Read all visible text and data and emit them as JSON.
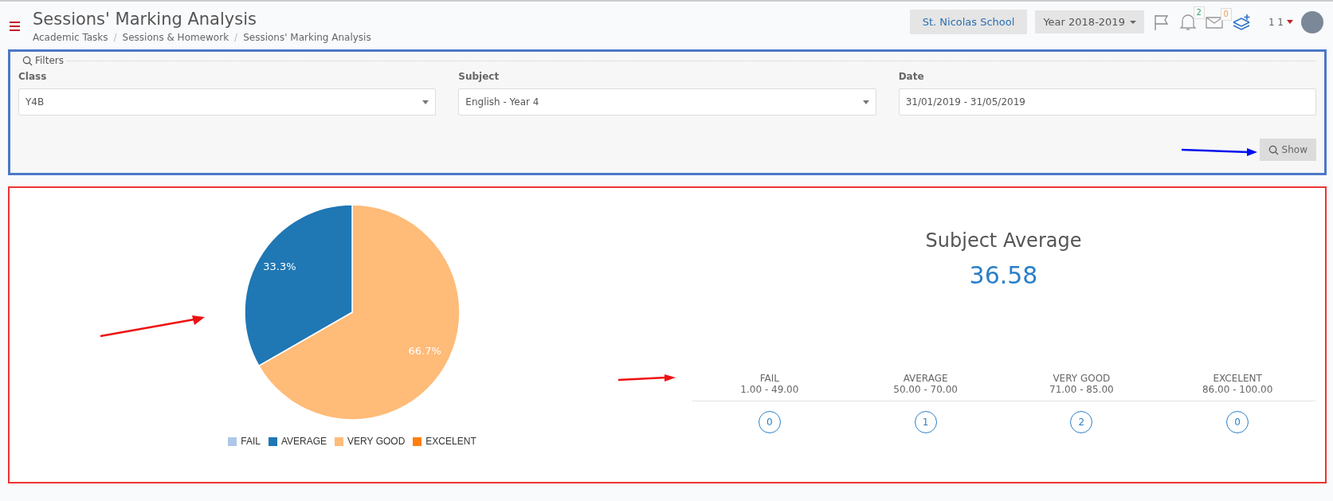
{
  "header": {
    "title": "Sessions' Marking Analysis",
    "breadcrumb": [
      "Academic Tasks",
      "Sessions & Homework",
      "Sessions' Marking Analysis"
    ],
    "school": "St. Nicolas School",
    "year": "Year 2018-2019",
    "separator": "/",
    "notifications": "2",
    "messages": "0",
    "user": "1 1"
  },
  "filters": {
    "legend": "Filters",
    "fields": [
      {
        "label": "Class",
        "value": "Y4B",
        "kind": "select"
      },
      {
        "label": "Subject",
        "value": "English - Year 4",
        "kind": "select"
      },
      {
        "label": "Date",
        "value": "31/01/2019 - 31/05/2019",
        "kind": "text"
      }
    ],
    "button": "Show"
  },
  "chart_data": {
    "type": "pie",
    "categories": [
      "FAIL",
      "AVERAGE",
      "VERY GOOD",
      "EXCELENT"
    ],
    "values": [
      0,
      33.3,
      66.7,
      0
    ],
    "colors": [
      "#aec7e8",
      "#1f77b4",
      "#ffbb78",
      "#ff7f0e"
    ],
    "data_labels": true,
    "value_labels": [
      null,
      "33.3%",
      "66.7%",
      null
    ],
    "legend": "bottom"
  },
  "average": {
    "title": "Subject Average",
    "value": "36.58"
  },
  "grades": [
    {
      "name": "FAIL",
      "range": "1.00 - 49.00",
      "count": "0"
    },
    {
      "name": "AVERAGE",
      "range": "50.00 - 70.00",
      "count": "1"
    },
    {
      "name": "VERY GOOD",
      "range": "71.00 - 85.00",
      "count": "2"
    },
    {
      "name": "EXCELENT",
      "range": "86.00 - 100.00",
      "count": "0"
    }
  ]
}
